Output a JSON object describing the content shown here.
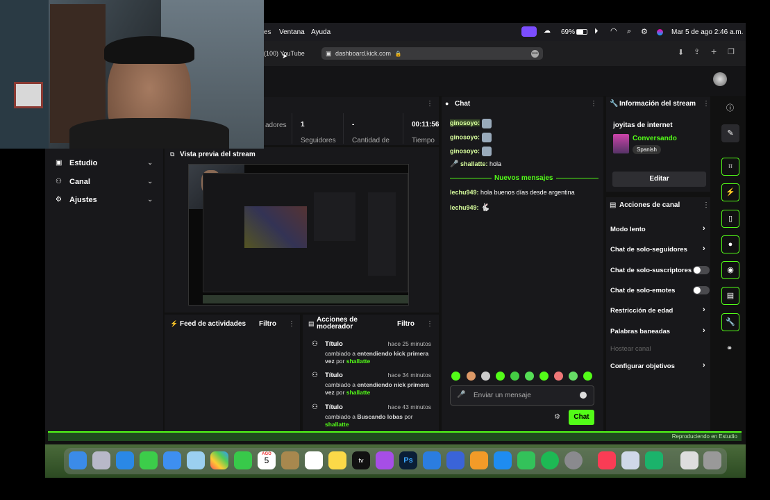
{
  "menubar": {
    "items": [
      "es",
      "Ventana",
      "Ayuda"
    ],
    "battery": "69%",
    "datetime": "Mar 5 de ago  2:46 a.m."
  },
  "browser": {
    "tab_youtube": "(100) YouTube",
    "url": "dashboard.kick.com"
  },
  "sidebar": {
    "items": [
      {
        "label": "Estudio",
        "icon": "video-icon"
      },
      {
        "label": "Canal",
        "icon": "people-icon"
      },
      {
        "label": "Ajustes",
        "icon": "gear-icon"
      }
    ]
  },
  "stats": [
    {
      "value": "",
      "label": "adores"
    },
    {
      "value": "1",
      "label": "Seguidores"
    },
    {
      "value": "-",
      "label": "Cantidad de"
    },
    {
      "value": "00:11:56",
      "label": "Tiempo"
    }
  ],
  "preview": {
    "title": "Vista previa del stream"
  },
  "activity": {
    "title": "Feed de actividades",
    "filter": "Filtro"
  },
  "moderator": {
    "title": "Acciones de moderador",
    "filter": "Filtro",
    "entries": [
      {
        "title": "Título",
        "time": "hace 25 minutos",
        "prefix": "cambiado a ",
        "bold": "entendiendo kick primera vez",
        "by": " por ",
        "user": "shallatte"
      },
      {
        "title": "Título",
        "time": "hace 34 minutos",
        "prefix": "cambiado a ",
        "bold": "entendiendo nick primera vez",
        "by": " por ",
        "user": "shallatte"
      },
      {
        "title": "Título",
        "time": "hace 43 minutos",
        "prefix": "cambiado a ",
        "bold": "Buscando lobas",
        "by": " por ",
        "user": "shallatte"
      }
    ]
  },
  "chat": {
    "title": "Chat",
    "messages": [
      {
        "user": "ginosoyo:",
        "text": ""
      },
      {
        "user": "ginosoyo:",
        "text": ""
      },
      {
        "user": "ginosoyo:",
        "text": ""
      },
      {
        "user": "shallatte:",
        "text": "hola"
      }
    ],
    "new_messages": "Nuevos mensajes",
    "new": [
      {
        "user": "lechu949:",
        "text": "hola buenos días desde argentina"
      },
      {
        "user": "lechu949:",
        "text": ""
      }
    ],
    "placeholder": "Enviar un mensaje",
    "send": "Chat"
  },
  "stream_info": {
    "title": "Información del stream",
    "stream_title": "joyitas de internet",
    "category": "Conversando",
    "language": "Spanish",
    "edit": "Editar"
  },
  "channel_actions": {
    "title": "Acciones de canal",
    "items": [
      {
        "label": "Modo lento",
        "kind": "arrow"
      },
      {
        "label": "Chat de solo-seguidores",
        "kind": "arrow"
      },
      {
        "label": "Chat de solo-suscriptores",
        "kind": "toggle"
      },
      {
        "label": "Chat de solo-emotes",
        "kind": "toggle"
      },
      {
        "label": "Restricción de edad",
        "kind": "arrow"
      },
      {
        "label": "Palabras baneadas",
        "kind": "arrow"
      },
      {
        "label": "Hostear canal",
        "kind": "disabled"
      },
      {
        "label": "Configurar objetivos",
        "kind": "arrow"
      }
    ]
  },
  "status_bar": {
    "text": "Reproduciendo en Estudio"
  },
  "dock": {
    "calendar_month": "AGO",
    "calendar_day": "5",
    "tv": "tv",
    "ps": "Ps"
  },
  "colors": {
    "accent": "#53fc18",
    "panel": "#18181b",
    "background": "#111111"
  }
}
